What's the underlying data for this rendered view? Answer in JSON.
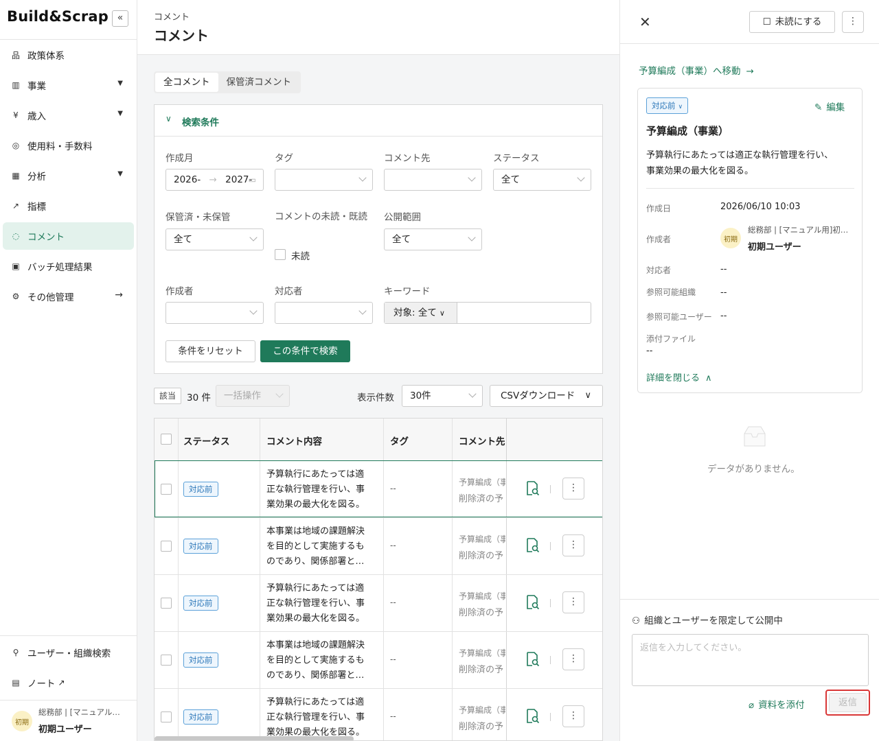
{
  "sidebar": {
    "logo": "Build&Scrap",
    "collapse_icon": "«",
    "items": [
      {
        "label": "政策体系",
        "icon": "hierarchy-icon",
        "glyph": "品",
        "has_chevron": false
      },
      {
        "label": "事業",
        "icon": "bar-chart-icon",
        "glyph": "▥",
        "has_chevron": true
      },
      {
        "label": "歳入",
        "icon": "revenue-icon",
        "glyph": "¥",
        "has_chevron": true
      },
      {
        "label": "使用料・手数料",
        "icon": "fee-icon",
        "glyph": "◎",
        "has_chevron": false
      },
      {
        "label": "分析",
        "icon": "analysis-icon",
        "glyph": "▦",
        "has_chevron": true
      },
      {
        "label": "指標",
        "icon": "trend-icon",
        "glyph": "↗",
        "has_chevron": false
      },
      {
        "label": "コメント",
        "icon": "comment-icon",
        "glyph": "◌",
        "has_chevron": false,
        "active": true
      },
      {
        "label": "バッチ処理結果",
        "icon": "terminal-icon",
        "glyph": "▣",
        "has_chevron": false
      },
      {
        "label": "その他管理",
        "icon": "gear-icon",
        "glyph": "⚙",
        "has_arrow": true
      }
    ],
    "bottom_items": [
      {
        "label": "ユーザー・組織検索",
        "icon": "search-icon",
        "glyph": "⚲"
      },
      {
        "label": "ノート",
        "icon": "book-icon",
        "glyph": "▤",
        "external_icon": "↗"
      }
    ],
    "user": {
      "avatar": "初期",
      "org": "総務部 | [マニュアル…",
      "name": "初期ユーザー"
    }
  },
  "main": {
    "breadcrumb": "コメント",
    "title": "コメント",
    "tabs": [
      "全コメント",
      "保管済コメント"
    ],
    "search": {
      "header": "検索条件",
      "fields": {
        "created_month": {
          "label": "作成月",
          "from": "2026-",
          "to": "2027-"
        },
        "tag": {
          "label": "タグ",
          "value": ""
        },
        "comment_target": {
          "label": "コメント先",
          "value": ""
        },
        "status": {
          "label": "ステータス",
          "value": "全て"
        },
        "archived": {
          "label": "保管済・未保管",
          "value": "全て"
        },
        "read_state": {
          "label": "コメントの未読・既読",
          "checkbox_label": "未読"
        },
        "visibility": {
          "label": "公開範囲",
          "value": "全て"
        },
        "author": {
          "label": "作成者",
          "value": ""
        },
        "assignee": {
          "label": "対応者",
          "value": ""
        },
        "keyword": {
          "label": "キーワード",
          "scope": "対象: 全て",
          "value": ""
        }
      },
      "reset_label": "条件をリセット",
      "search_label": "この条件で検索"
    },
    "results": {
      "count_tag": "該当",
      "count": "30 件",
      "bulk_label": "一括操作",
      "per_page_label": "表示件数",
      "per_page_value": "30件",
      "csv_label": "CSVダウンロード"
    },
    "table": {
      "headers": [
        "ステータス",
        "コメント内容",
        "タグ",
        "コメント先"
      ],
      "rows": [
        {
          "status": "対応前",
          "content": [
            "予算執行にあたっては適",
            "正な執行管理を行い、事",
            "業効果の最大化を図る。"
          ],
          "tag": "--",
          "target1": "予算編成（事",
          "target2": "削除済の予",
          "selected": true
        },
        {
          "status": "対応前",
          "content": [
            "本事業は地域の課題解決",
            "を目的として実施するも",
            "のであり、関係部署と…"
          ],
          "tag": "--",
          "target1": "予算編成（事",
          "target2": "削除済の予"
        },
        {
          "status": "対応前",
          "content": [
            "予算執行にあたっては適",
            "正な執行管理を行い、事",
            "業効果の最大化を図る。"
          ],
          "tag": "--",
          "target1": "予算編成（事",
          "target2": "削除済の予"
        },
        {
          "status": "対応前",
          "content": [
            "本事業は地域の課題解決",
            "を目的として実施するも",
            "のであり、関係部署と…"
          ],
          "tag": "--",
          "target1": "予算編成（事",
          "target2": "削除済の予"
        },
        {
          "status": "対応前",
          "content": [
            "予算執行にあたっては適",
            "正な執行管理を行い、事",
            "業効果の最大化を図る。"
          ],
          "tag": "--",
          "target1": "予算編成（事",
          "target2": "削除済の予"
        }
      ]
    }
  },
  "detail": {
    "mark_unread_label": "未読にする",
    "goto_link": "予算編成（事業）へ移動",
    "status": "対応前",
    "edit_label": "編集",
    "title": "予算編成（事業）",
    "body": [
      "予算執行にあたっては適正な執行管理を行い、",
      "事業効果の最大化を図る。"
    ],
    "created_label": "作成日",
    "created_value": "2026/06/10 10:03",
    "author_label": "作成者",
    "author_avatar": "初期",
    "author_org": "総務部 | [マニュアル用]初…",
    "author_name": "初期ユーザー",
    "assignee_label": "対応者",
    "assignee_value": "--",
    "org_label": "参照可能組織",
    "org_value": "--",
    "users_label": "参照可能ユーザー",
    "users_value": "--",
    "attach_label": "添付ファイル",
    "attach_value": "--",
    "collapse_label": "詳細を閉じる",
    "empty_text": "データがありません。",
    "visibility_text": "組織とユーザーを限定して公開中",
    "reply_placeholder": "返信を入力してください。",
    "attach_button": "資料を添付",
    "reply_button": "返信"
  },
  "colors": {
    "accent": "#1f7a5a",
    "badge": "#2a76b8",
    "highlight": "#d93636"
  }
}
